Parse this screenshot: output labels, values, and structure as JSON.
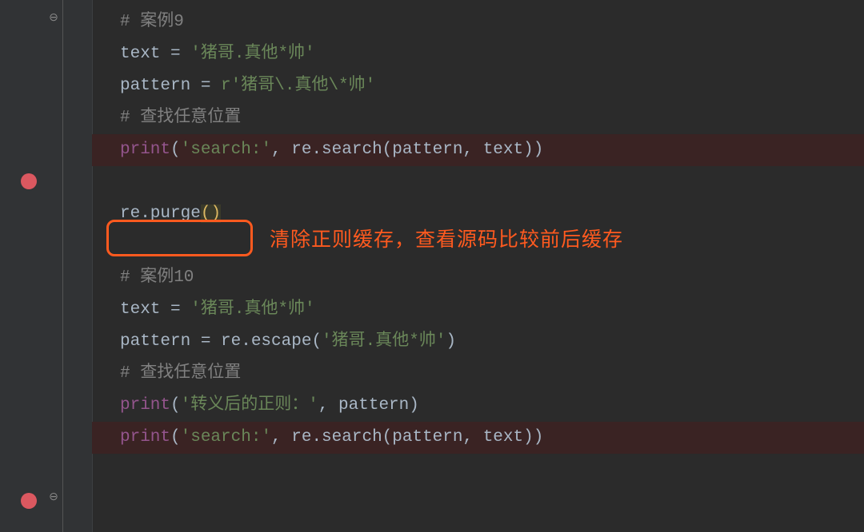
{
  "code": {
    "l1_comment": "# 案例9",
    "l2_lhs": "text",
    "l2_eq": " = ",
    "l2_str": "'猪哥.真他*帅'",
    "l3_lhs": "pattern",
    "l3_eq": " = ",
    "l3_str": "r'猪哥\\.真他\\*帅'",
    "l4_comment": "# 查找任意位置",
    "l5_print": "print",
    "l5_open": "(",
    "l5_str": "'search:'",
    "l5_comma": ", re.search(pattern, text))",
    "l7_re": "re.purge",
    "l7_open": "(",
    "l7_close": ")",
    "l9_comment": "# 案例10",
    "l10_lhs": "text",
    "l10_eq": " = ",
    "l10_str": "'猪哥.真他*帅'",
    "l11_lhs": "pattern",
    "l11_eq": " = re.escape(",
    "l11_str": "'猪哥.真他*帅'",
    "l11_close": ")",
    "l12_comment": "# 查找任意位置",
    "l13_print": "print",
    "l13_open": "(",
    "l13_str": "'转义后的正则：'",
    "l13_rest": ", pattern)",
    "l14_print": "print",
    "l14_open": "(",
    "l14_str": "'search:'",
    "l14_rest": ", re.search(pattern, text))"
  },
  "annotation": "清除正则缓存，查看源码比较前后缓存",
  "icons": {
    "fold_close": "⊖",
    "fold_close2": "⊖"
  }
}
